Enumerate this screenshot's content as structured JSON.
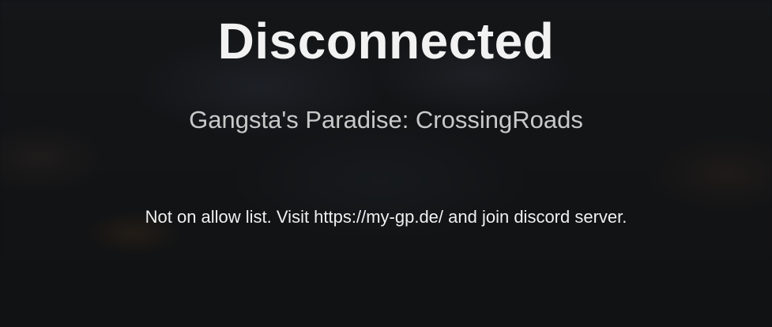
{
  "screen": {
    "title": "Disconnected",
    "server_name": "Gangsta's Paradise: CrossingRoads",
    "reason": "Not on allow list. Visit https://my-gp.de/ and join discord server."
  }
}
